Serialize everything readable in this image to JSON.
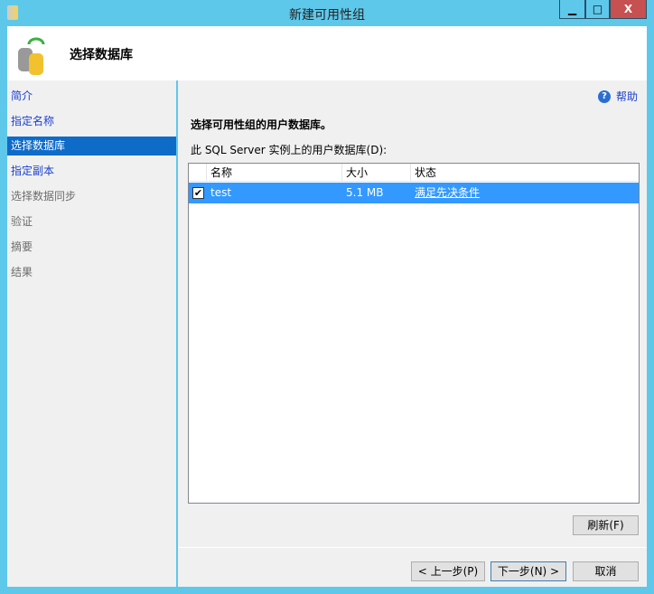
{
  "window": {
    "title": "新建可用性组",
    "minimize": "▁",
    "maximize": "□",
    "close": "X"
  },
  "header": {
    "title": "选择数据库"
  },
  "sidebar": {
    "items": [
      {
        "label": "简介",
        "state": "link"
      },
      {
        "label": "指定名称",
        "state": "link"
      },
      {
        "label": "选择数据库",
        "state": "selected"
      },
      {
        "label": "指定副本",
        "state": "link"
      },
      {
        "label": "选择数据同步",
        "state": "disabled"
      },
      {
        "label": "验证",
        "state": "disabled"
      },
      {
        "label": "摘要",
        "state": "disabled"
      },
      {
        "label": "结果",
        "state": "disabled"
      }
    ]
  },
  "main": {
    "help": "帮助",
    "heading": "选择可用性组的用户数据库。",
    "list_label": "此 SQL Server 实例上的用户数据库(D):",
    "columns": [
      "名称",
      "大小",
      "状态"
    ],
    "rows": [
      {
        "checked": true,
        "name": "test",
        "size": "5.1 MB",
        "status": "满足先决条件"
      }
    ],
    "refresh": "刷新(F)"
  },
  "footer": {
    "prev": "< 上一步(P)",
    "next": "下一步(N) >",
    "cancel": "取消"
  }
}
